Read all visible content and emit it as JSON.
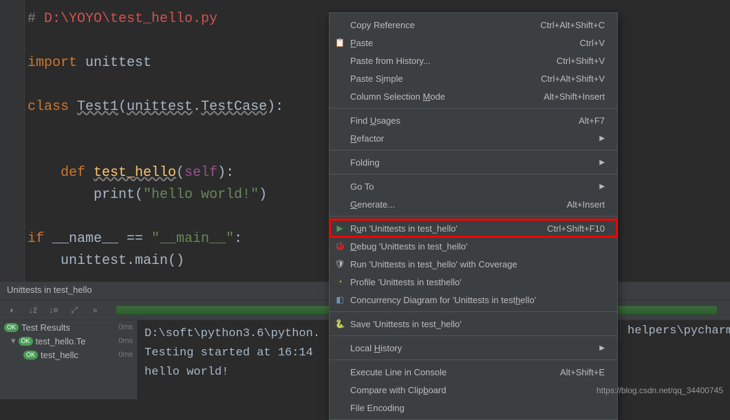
{
  "code": {
    "l1_hash": "# ",
    "l1_path": "D:\\YOYO\\test_hello.py",
    "l2_import": "import ",
    "l2_mod": "unittest",
    "l3_class": "class ",
    "l3_name": "Test1",
    "l3_rest1": "(",
    "l3_rest2": "unittest",
    "l3_rest3": ".",
    "l3_rest4": "TestCase",
    "l3_rest5": "):",
    "l4_def": "    def ",
    "l4_name": "test_hello",
    "l4_p1": "(",
    "l4_self": "self",
    "l4_p2": "):",
    "l5_pre": "        ",
    "l5_print": "print",
    "l5_p1": "(",
    "l5_str": "\"hello world!\"",
    "l5_p2": ")",
    "l6_if": "if ",
    "l6_name": "__name__",
    "l6_eq": " == ",
    "l6_main": "\"__main__\"",
    "l6_colon": ":",
    "l7_pre": "    ",
    "l7_call": "unittest.main()"
  },
  "run": {
    "tab": "Unittests in test_hello",
    "testResults": "Test Results",
    "ms": "0ms",
    "node1": "test_hello.Te",
    "node2": "test_hellc",
    "chev": "»",
    "out1": "D:\\soft\\python3.6\\python.",
    "out2": "Testing started at 16:14",
    "out3": "hello world!",
    "rightTrunc": "helpers\\pycharm\\u"
  },
  "menu": {
    "copyRef": {
      "label": "Copy Reference",
      "sc": "Ctrl+Alt+Shift+C"
    },
    "paste": {
      "pre": "",
      "u": "P",
      "post": "aste",
      "sc": "Ctrl+V"
    },
    "pasteHist": {
      "label": "Paste from History...",
      "sc": "Ctrl+Shift+V",
      "u": null
    },
    "pasteSimple": {
      "pre": "Paste S",
      "u": "i",
      "post": "mple",
      "sc": "Ctrl+Alt+Shift+V"
    },
    "colSel": {
      "pre": "Column Selection ",
      "u": "M",
      "post": "ode",
      "sc": "Alt+Shift+Insert"
    },
    "findUsages": {
      "pre": "Find ",
      "u": "U",
      "post": "sages",
      "sc": "Alt+F7"
    },
    "refactor": {
      "pre": "",
      "u": "R",
      "post": "efactor"
    },
    "folding": {
      "label": "Folding"
    },
    "goto": {
      "label": "Go To"
    },
    "generate": {
      "pre": "",
      "u": "G",
      "post": "enerate...",
      "sc": "Alt+Insert"
    },
    "run": {
      "pre": "R",
      "u": "u",
      "post": "n 'Unittests in test_hello'",
      "sc": "Ctrl+Shift+F10"
    },
    "debug": {
      "pre": "",
      "u": "D",
      "post": "ebug 'Unittests in test_hello'"
    },
    "coverage": {
      "label": "Run 'Unittests in test_hello' with Coverage",
      "u": null
    },
    "profile": {
      "label": "Profile 'Unittests in testhello'"
    },
    "concurrency": {
      "pre": "Concurrency Diagram for  'Unittests in test",
      "u": "h",
      "post": "ello'"
    },
    "save": {
      "label": "Save 'Unittests in test_hello'"
    },
    "localHist": {
      "pre": "Local ",
      "u": "H",
      "post": "istory"
    },
    "execLine": {
      "label": "Execute Line in Console",
      "sc": "Alt+Shift+E"
    },
    "compClip": {
      "pre": "Compare with Clip",
      "u": "b",
      "post": "oard"
    },
    "fileEnc": {
      "label": "File Encoding"
    }
  },
  "watermark": "https://blog.csdn.net/qq_34400745"
}
